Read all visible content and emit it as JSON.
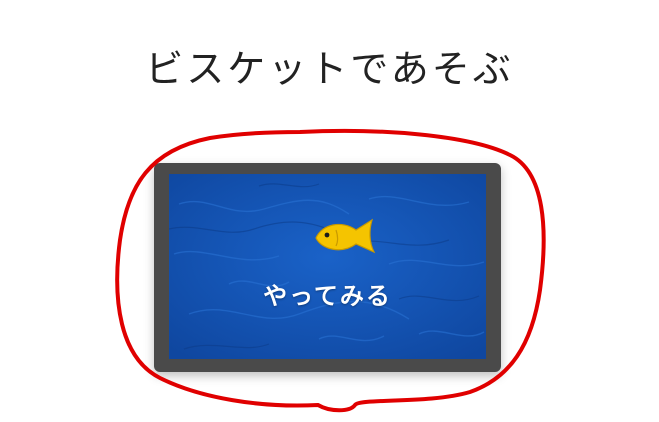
{
  "page": {
    "title": "ビスケットであそぶ"
  },
  "card": {
    "button_label": "やってみる",
    "icon": "fish-icon"
  },
  "colors": {
    "device_frame": "#4a4a4a",
    "screen_blue": "#1453b3",
    "fish_yellow": "#f5c400",
    "annotation_red": "#e00000"
  }
}
